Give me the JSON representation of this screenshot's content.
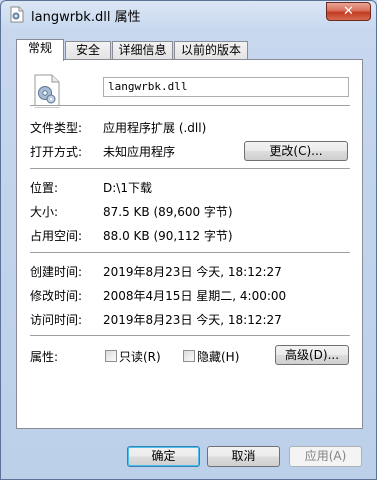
{
  "window": {
    "title": "langwrbk.dll 属性",
    "close_label": "✕"
  },
  "tabs": [
    {
      "label": "常规"
    },
    {
      "label": "安全"
    },
    {
      "label": "详细信息"
    },
    {
      "label": "以前的版本"
    }
  ],
  "general": {
    "filename": "langwrbk.dll",
    "file_type_label": "文件类型:",
    "file_type_value": "应用程序扩展 (.dll)",
    "opens_with_label": "打开方式:",
    "opens_with_value": "未知应用程序",
    "change_button": "更改(C)...",
    "location_label": "位置:",
    "location_value": "D:\\1下载",
    "size_label": "大小:",
    "size_value": "87.5 KB (89,600 字节)",
    "size_on_disk_label": "占用空间:",
    "size_on_disk_value": "88.0 KB (90,112 字节)",
    "created_label": "创建时间:",
    "created_value": "2019年8月23日 今天, 18:12:27",
    "modified_label": "修改时间:",
    "modified_value": "2008年4月15日 星期二, 4:00:00",
    "accessed_label": "访问时间:",
    "accessed_value": "2019年8月23日 今天, 18:12:27",
    "attributes_label": "属性:",
    "readonly_label": "只读(R)",
    "hidden_label": "隐藏(H)",
    "advanced_button": "高级(D)..."
  },
  "footer": {
    "ok": "确定",
    "cancel": "取消",
    "apply": "应用(A)"
  }
}
